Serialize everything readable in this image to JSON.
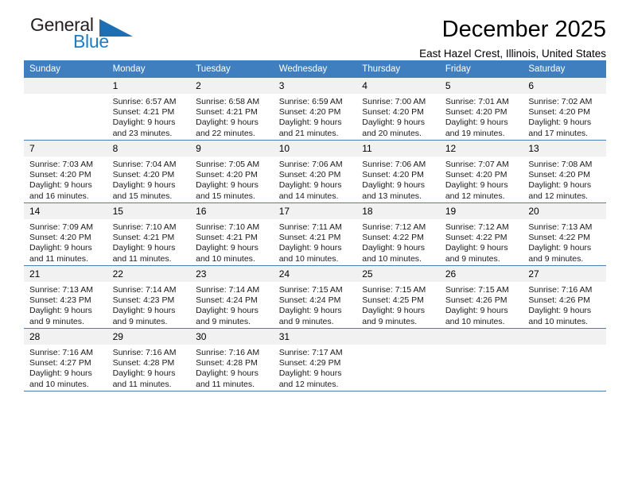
{
  "brand": {
    "name_part1": "General",
    "name_part2": "Blue",
    "triangle_icon": "triangle-icon",
    "color_dark": "#231f20",
    "color_blue": "#1c7cc4"
  },
  "header": {
    "title": "December 2025",
    "subtitle": "East Hazel Crest, Illinois, United States"
  },
  "calendar": {
    "header_bg": "#3f7fbf",
    "header_text_color": "#ffffff",
    "daynum_bg": "#f1f1f1",
    "row_border_color": "#4a7fb5",
    "weekdays": [
      "Sunday",
      "Monday",
      "Tuesday",
      "Wednesday",
      "Thursday",
      "Friday",
      "Saturday"
    ],
    "weeks": [
      [
        {
          "day": "",
          "lines": []
        },
        {
          "day": "1",
          "lines": [
            "Sunrise: 6:57 AM",
            "Sunset: 4:21 PM",
            "Daylight: 9 hours",
            "and 23 minutes."
          ]
        },
        {
          "day": "2",
          "lines": [
            "Sunrise: 6:58 AM",
            "Sunset: 4:21 PM",
            "Daylight: 9 hours",
            "and 22 minutes."
          ]
        },
        {
          "day": "3",
          "lines": [
            "Sunrise: 6:59 AM",
            "Sunset: 4:20 PM",
            "Daylight: 9 hours",
            "and 21 minutes."
          ]
        },
        {
          "day": "4",
          "lines": [
            "Sunrise: 7:00 AM",
            "Sunset: 4:20 PM",
            "Daylight: 9 hours",
            "and 20 minutes."
          ]
        },
        {
          "day": "5",
          "lines": [
            "Sunrise: 7:01 AM",
            "Sunset: 4:20 PM",
            "Daylight: 9 hours",
            "and 19 minutes."
          ]
        },
        {
          "day": "6",
          "lines": [
            "Sunrise: 7:02 AM",
            "Sunset: 4:20 PM",
            "Daylight: 9 hours",
            "and 17 minutes."
          ]
        }
      ],
      [
        {
          "day": "7",
          "lines": [
            "Sunrise: 7:03 AM",
            "Sunset: 4:20 PM",
            "Daylight: 9 hours",
            "and 16 minutes."
          ]
        },
        {
          "day": "8",
          "lines": [
            "Sunrise: 7:04 AM",
            "Sunset: 4:20 PM",
            "Daylight: 9 hours",
            "and 15 minutes."
          ]
        },
        {
          "day": "9",
          "lines": [
            "Sunrise: 7:05 AM",
            "Sunset: 4:20 PM",
            "Daylight: 9 hours",
            "and 15 minutes."
          ]
        },
        {
          "day": "10",
          "lines": [
            "Sunrise: 7:06 AM",
            "Sunset: 4:20 PM",
            "Daylight: 9 hours",
            "and 14 minutes."
          ]
        },
        {
          "day": "11",
          "lines": [
            "Sunrise: 7:06 AM",
            "Sunset: 4:20 PM",
            "Daylight: 9 hours",
            "and 13 minutes."
          ]
        },
        {
          "day": "12",
          "lines": [
            "Sunrise: 7:07 AM",
            "Sunset: 4:20 PM",
            "Daylight: 9 hours",
            "and 12 minutes."
          ]
        },
        {
          "day": "13",
          "lines": [
            "Sunrise: 7:08 AM",
            "Sunset: 4:20 PM",
            "Daylight: 9 hours",
            "and 12 minutes."
          ]
        }
      ],
      [
        {
          "day": "14",
          "lines": [
            "Sunrise: 7:09 AM",
            "Sunset: 4:20 PM",
            "Daylight: 9 hours",
            "and 11 minutes."
          ]
        },
        {
          "day": "15",
          "lines": [
            "Sunrise: 7:10 AM",
            "Sunset: 4:21 PM",
            "Daylight: 9 hours",
            "and 11 minutes."
          ]
        },
        {
          "day": "16",
          "lines": [
            "Sunrise: 7:10 AM",
            "Sunset: 4:21 PM",
            "Daylight: 9 hours",
            "and 10 minutes."
          ]
        },
        {
          "day": "17",
          "lines": [
            "Sunrise: 7:11 AM",
            "Sunset: 4:21 PM",
            "Daylight: 9 hours",
            "and 10 minutes."
          ]
        },
        {
          "day": "18",
          "lines": [
            "Sunrise: 7:12 AM",
            "Sunset: 4:22 PM",
            "Daylight: 9 hours",
            "and 10 minutes."
          ]
        },
        {
          "day": "19",
          "lines": [
            "Sunrise: 7:12 AM",
            "Sunset: 4:22 PM",
            "Daylight: 9 hours",
            "and 9 minutes."
          ]
        },
        {
          "day": "20",
          "lines": [
            "Sunrise: 7:13 AM",
            "Sunset: 4:22 PM",
            "Daylight: 9 hours",
            "and 9 minutes."
          ]
        }
      ],
      [
        {
          "day": "21",
          "lines": [
            "Sunrise: 7:13 AM",
            "Sunset: 4:23 PM",
            "Daylight: 9 hours",
            "and 9 minutes."
          ]
        },
        {
          "day": "22",
          "lines": [
            "Sunrise: 7:14 AM",
            "Sunset: 4:23 PM",
            "Daylight: 9 hours",
            "and 9 minutes."
          ]
        },
        {
          "day": "23",
          "lines": [
            "Sunrise: 7:14 AM",
            "Sunset: 4:24 PM",
            "Daylight: 9 hours",
            "and 9 minutes."
          ]
        },
        {
          "day": "24",
          "lines": [
            "Sunrise: 7:15 AM",
            "Sunset: 4:24 PM",
            "Daylight: 9 hours",
            "and 9 minutes."
          ]
        },
        {
          "day": "25",
          "lines": [
            "Sunrise: 7:15 AM",
            "Sunset: 4:25 PM",
            "Daylight: 9 hours",
            "and 9 minutes."
          ]
        },
        {
          "day": "26",
          "lines": [
            "Sunrise: 7:15 AM",
            "Sunset: 4:26 PM",
            "Daylight: 9 hours",
            "and 10 minutes."
          ]
        },
        {
          "day": "27",
          "lines": [
            "Sunrise: 7:16 AM",
            "Sunset: 4:26 PM",
            "Daylight: 9 hours",
            "and 10 minutes."
          ]
        }
      ],
      [
        {
          "day": "28",
          "lines": [
            "Sunrise: 7:16 AM",
            "Sunset: 4:27 PM",
            "Daylight: 9 hours",
            "and 10 minutes."
          ]
        },
        {
          "day": "29",
          "lines": [
            "Sunrise: 7:16 AM",
            "Sunset: 4:28 PM",
            "Daylight: 9 hours",
            "and 11 minutes."
          ]
        },
        {
          "day": "30",
          "lines": [
            "Sunrise: 7:16 AM",
            "Sunset: 4:28 PM",
            "Daylight: 9 hours",
            "and 11 minutes."
          ]
        },
        {
          "day": "31",
          "lines": [
            "Sunrise: 7:17 AM",
            "Sunset: 4:29 PM",
            "Daylight: 9 hours",
            "and 12 minutes."
          ]
        },
        {
          "day": "",
          "lines": []
        },
        {
          "day": "",
          "lines": []
        },
        {
          "day": "",
          "lines": []
        }
      ]
    ]
  }
}
